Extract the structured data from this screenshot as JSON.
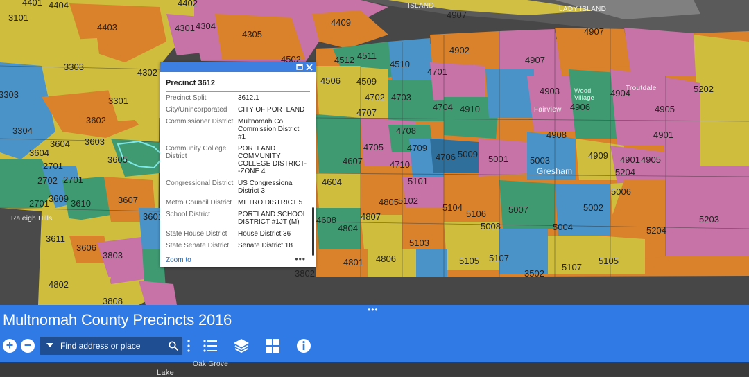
{
  "map": {
    "precinct_labels": [
      "4401",
      "4404",
      "4402",
      "4907",
      "3101",
      "4403",
      "4301",
      "4304",
      "4409",
      "4305",
      "4907",
      "3303",
      "4902",
      "4502",
      "4512",
      "4511",
      "4510",
      "4907",
      "4302",
      "4701",
      "3303",
      "4506",
      "4509",
      "4903",
      "4904",
      "5202",
      "3301",
      "4702",
      "4703",
      "4704",
      "4910",
      "4906",
      "4905",
      "4707",
      "3602",
      "3304",
      "4708",
      "4908",
      "4901",
      "3604",
      "3603",
      "4705",
      "4709",
      "4909",
      "4901",
      "4905",
      "3604",
      "3605",
      "4607",
      "4710",
      "4706",
      "5009",
      "5001",
      "5003",
      "5204",
      "2701",
      "2702",
      "2701",
      "4604",
      "5101",
      "5006",
      "2701",
      "3609",
      "3610",
      "3607",
      "4805",
      "5102",
      "5104",
      "5106",
      "5007",
      "5002",
      "3601",
      "4608",
      "4807",
      "4804",
      "5008",
      "5004",
      "5204",
      "5203",
      "3611",
      "3606",
      "5103",
      "3803",
      "4801",
      "4806",
      "5105",
      "5107",
      "5107",
      "5105",
      "3502",
      "4802",
      "3802",
      "3808"
    ],
    "place_labels": [
      "ISLAND",
      "LADY ISLAND",
      "Wood Village",
      "Troutdale",
      "Fairview",
      "Gresham",
      "Raleigh Hills",
      "Oak Grove",
      "Lake"
    ]
  },
  "popup": {
    "title": "Precinct 3612",
    "rows": [
      {
        "key": "Precinct Split",
        "value": "3612.1"
      },
      {
        "key": "City/Unincorporated",
        "value": "CITY OF PORTLAND"
      },
      {
        "key": "Commissioner District",
        "value": "Multnomah Co Commission District #1"
      },
      {
        "key": "Community College District",
        "value": "PORTLAND COMMUNITY COLLEGE DISTRICT--ZONE 4"
      },
      {
        "key": "Congressional District",
        "value": "US Congressional District 3"
      },
      {
        "key": "Metro Council District",
        "value": "METRO DISTRICT 5"
      },
      {
        "key": "School District",
        "value": "PORTLAND SCHOOL DISTRICT #1JT (M)"
      },
      {
        "key": "State House District",
        "value": "House District 36"
      },
      {
        "key": "State Senate District",
        "value": "Senate District 18"
      }
    ],
    "zoom_to": "Zoom to",
    "more": "•••",
    "maximize_icon": "maximize-icon",
    "close_icon": "close-icon"
  },
  "panel": {
    "title": "Multnomah County Precincts 2016",
    "grip": "•••",
    "zoom_in": "+",
    "zoom_out": "−",
    "search_placeholder": "Find address or place",
    "tools": [
      "legend-icon",
      "layers-icon",
      "basemap-icon",
      "info-icon"
    ]
  },
  "colors": {
    "accent": "#2f7ae5",
    "orange": "#d9812b",
    "pink": "#c873a8",
    "yellow": "#cfbd3e",
    "blue": "#4a93c8",
    "green": "#3f9a72",
    "base": "#3d3d3d"
  }
}
